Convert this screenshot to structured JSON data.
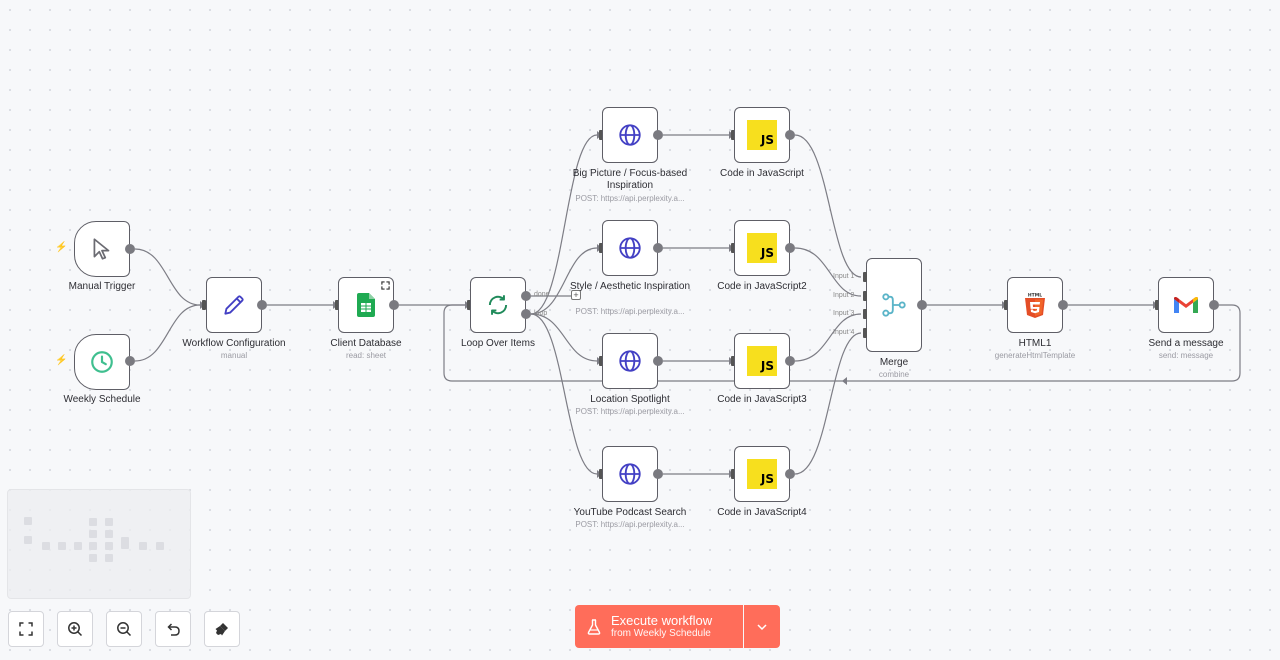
{
  "colors": {
    "accent": "#ff6d5a",
    "globe": "#4340c4",
    "loop": "#1f8a5a",
    "schedule": "#3fbf8f",
    "sheets": "#1faa52",
    "merge": "#5ab4c8",
    "html5": "#e44d26",
    "js": "#f7df1e"
  },
  "nodes": {
    "manual_trigger": {
      "label": "Manual Trigger",
      "icon": "cursor-icon"
    },
    "weekly_schedule": {
      "label": "Weekly Schedule",
      "icon": "clock-icon"
    },
    "workflow_config": {
      "label": "Workflow Configuration",
      "sub": "manual",
      "icon": "pencil-icon"
    },
    "client_db": {
      "label": "Client Database",
      "sub": "read: sheet",
      "icon": "google-sheets-icon"
    },
    "loop": {
      "label": "Loop Over Items",
      "icon": "refresh-icon",
      "done_label": "done",
      "loop_label": "loop"
    },
    "big_picture": {
      "label": "Big Picture / Focus-based Inspiration",
      "sub": "POST: https://api.perplexity.a...",
      "icon": "globe-icon"
    },
    "style": {
      "label": "Style / Aesthetic Inspiration",
      "sub": "POST: https://api.perplexity.a...",
      "icon": "globe-icon"
    },
    "location": {
      "label": "Location Spotlight",
      "sub": "POST: https://api.perplexity.a...",
      "icon": "globe-icon"
    },
    "youtube": {
      "label": "YouTube Podcast Search",
      "sub": "POST: https://api.perplexity.a...",
      "icon": "globe-icon"
    },
    "code1": {
      "label": "Code in JavaScript",
      "icon": "javascript-icon",
      "badge": "JS"
    },
    "code2": {
      "label": "Code in JavaScript2",
      "icon": "javascript-icon",
      "badge": "JS"
    },
    "code3": {
      "label": "Code in JavaScript3",
      "icon": "javascript-icon",
      "badge": "JS"
    },
    "code4": {
      "label": "Code in JavaScript4",
      "icon": "javascript-icon",
      "badge": "JS"
    },
    "merge": {
      "label": "Merge",
      "sub": "combine",
      "icon": "merge-icon",
      "inputs": [
        "Input 1",
        "Input 2",
        "Input 3",
        "Input 4"
      ]
    },
    "html1": {
      "label": "HTML1",
      "sub": "generateHtmlTemplate",
      "icon": "html5-icon"
    },
    "send": {
      "label": "Send a message",
      "sub": "send: message",
      "icon": "gmail-icon"
    }
  },
  "canvas_controls": {
    "fit": "fit-view-icon",
    "zoom_in": "zoom-in-icon",
    "zoom_out": "zoom-out-icon",
    "reset": "undo-icon",
    "tidy": "tidy-up-icon"
  },
  "execute": {
    "label": "Execute workflow",
    "from_prefix": "from",
    "from_node": "Weekly Schedule"
  }
}
